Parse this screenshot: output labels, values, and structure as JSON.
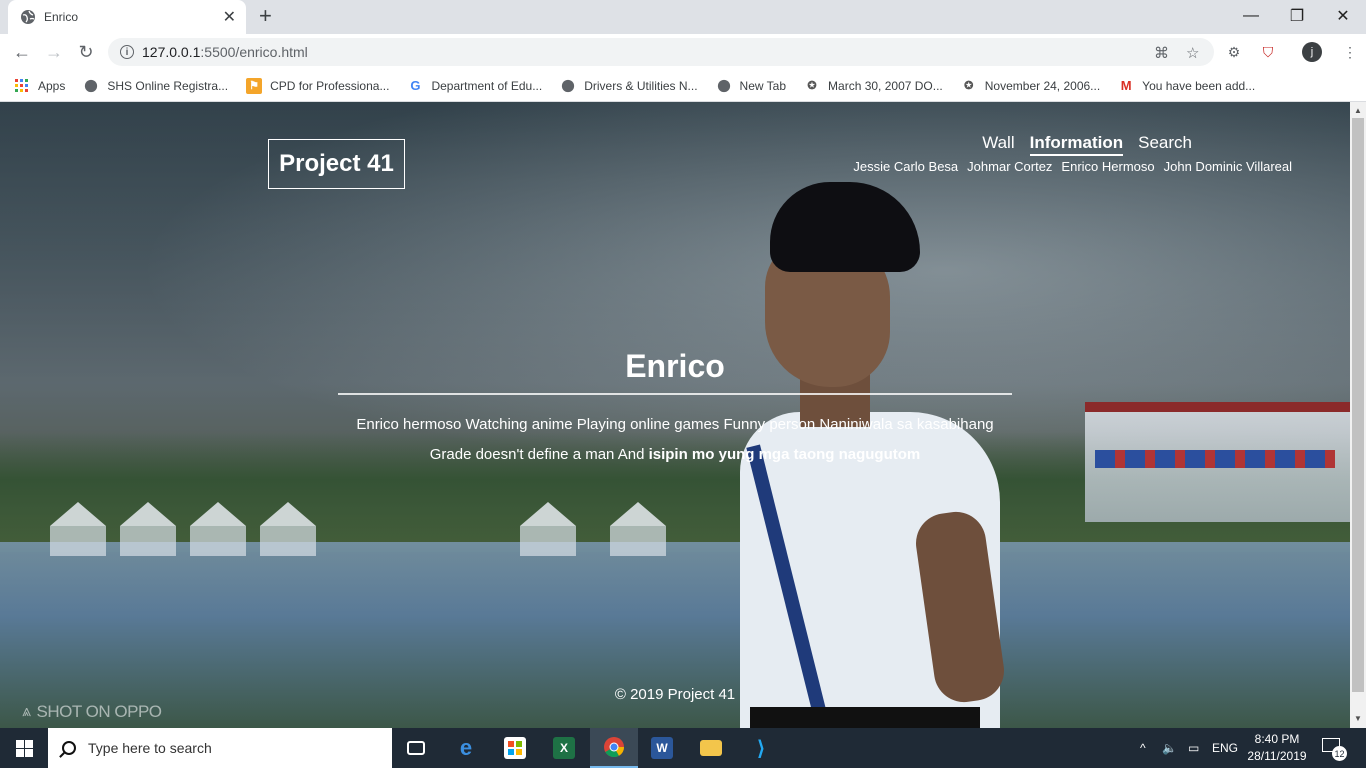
{
  "browser": {
    "tab_title": "Enrico",
    "url_host": "127.0.0.1",
    "url_rest": ":5500/enrico.html",
    "profile_initial": "j",
    "bookmarks": [
      {
        "label": "Apps",
        "icon": "apps-grid-icon"
      },
      {
        "label": "SHS Online Registra...",
        "icon": "globe-icon"
      },
      {
        "label": "CPD for Professiona...",
        "icon": "cpd-icon"
      },
      {
        "label": "Department of Edu...",
        "icon": "google-icon"
      },
      {
        "label": "Drivers & Utilities N...",
        "icon": "globe-icon"
      },
      {
        "label": "New Tab",
        "icon": "globe-icon"
      },
      {
        "label": "March 30, 2007 DO...",
        "icon": "deped-seal-icon"
      },
      {
        "label": "November 24, 2006...",
        "icon": "deped-seal-icon"
      },
      {
        "label": "You have been add...",
        "icon": "gmail-icon"
      }
    ]
  },
  "site": {
    "logo": "Project 41",
    "nav": [
      "Wall",
      "Information",
      "Search"
    ],
    "active_nav": "Information",
    "members": [
      "Jessie Carlo Besa",
      "Johmar Cortez",
      "Enrico Hermoso",
      "John Dominic Villareal"
    ],
    "hero_title": "Enrico",
    "hero_text_plain": "Enrico hermoso Watching anime Playing online games Funny person Naniniwala sa kasabihang Grade doesn't define a man And ",
    "hero_text_bold": "isipin mo yung mga taong nagugutom",
    "footer": "© 2019 Project 41",
    "watermark": "SHOT ON OPPO"
  },
  "taskbar": {
    "search_placeholder": "Type here to search",
    "apps": [
      "task-view",
      "edge",
      "store",
      "excel",
      "chrome",
      "word",
      "file-explorer",
      "vscode"
    ],
    "active_app": "chrome",
    "language": "ENG",
    "time": "8:40 PM",
    "date": "28/11/2019",
    "notification_count": "12"
  },
  "colors": {
    "chrome_tabstrip": "#dee1e6",
    "taskbar": "#1f2a36",
    "accent_blue": "#76b9ed"
  }
}
